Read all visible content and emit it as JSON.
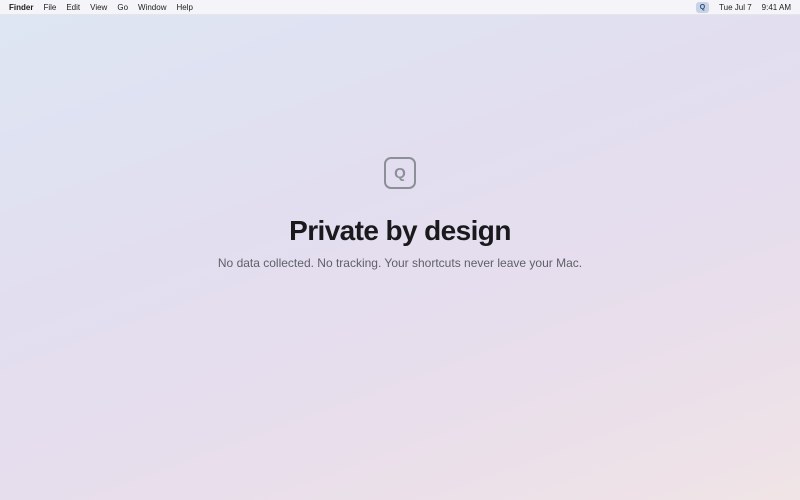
{
  "menubar": {
    "app_name": "Finder",
    "items": [
      "File",
      "Edit",
      "View",
      "Go",
      "Window",
      "Help"
    ],
    "status_icon_letter": "Q",
    "date": "Tue Jul 7",
    "time": "9:41 AM"
  },
  "hero": {
    "icon_letter": "Q",
    "title": "Private by design",
    "subtitle": "No data collected. No tracking. Your shortcuts never leave your Mac."
  },
  "colors": {
    "background_top": "#dde6f3",
    "background_bottom": "#f0e4e6",
    "icon_stroke": "#8d8f98",
    "status_icon_bg": "#c7d3e6"
  }
}
